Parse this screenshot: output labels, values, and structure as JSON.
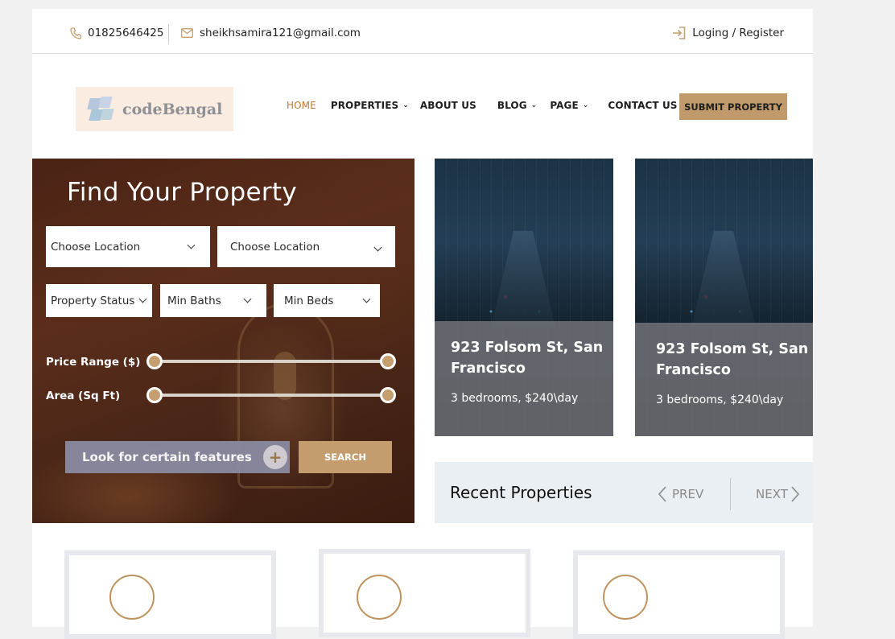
{
  "topbar": {
    "phone": "01825646425",
    "email": "sheikhsamira121@gmail.com",
    "login": "Loging / Register"
  },
  "logo": {
    "text": "codeBengal"
  },
  "nav": {
    "items": [
      {
        "label": "HOME",
        "active": true,
        "dropdown": false
      },
      {
        "label": "PROPERTIES",
        "active": false,
        "dropdown": true
      },
      {
        "label": "ABOUT US",
        "active": false,
        "dropdown": false
      },
      {
        "label": "BLOG",
        "active": false,
        "dropdown": true
      },
      {
        "label": "PAGE",
        "active": false,
        "dropdown": true
      },
      {
        "label": "CONTACT US",
        "active": false,
        "dropdown": false
      }
    ],
    "submit_label": "SUBMIT PROPERTY"
  },
  "search": {
    "title": "Find Your Property",
    "location1": "Choose Location",
    "location2": "Choose Location",
    "status": "Property Status",
    "baths": "Min Baths",
    "beds": "Min Beds",
    "price_label": "Price Range ($)",
    "area_label": "Area (Sq Ft)",
    "price_range": [
      0,
      1
    ],
    "area_range": [
      0,
      1
    ],
    "features_label": "Look for certain features",
    "features_icon": "plus-icon",
    "search_label": "SEARCH"
  },
  "cards": [
    {
      "title": "923 Folsom St, San Francisco",
      "desc": "3 bedrooms, $240\\day"
    },
    {
      "title": "923 Folsom St, San Francisco",
      "desc": "3 bedrooms, $240\\day"
    }
  ],
  "recent": {
    "title": "Recent Properties",
    "prev": "PREV",
    "next": "NEXT"
  },
  "colors": {
    "accent": "#c09a6b",
    "nav_active": "#c47a2c",
    "panel": "#4a2315"
  }
}
